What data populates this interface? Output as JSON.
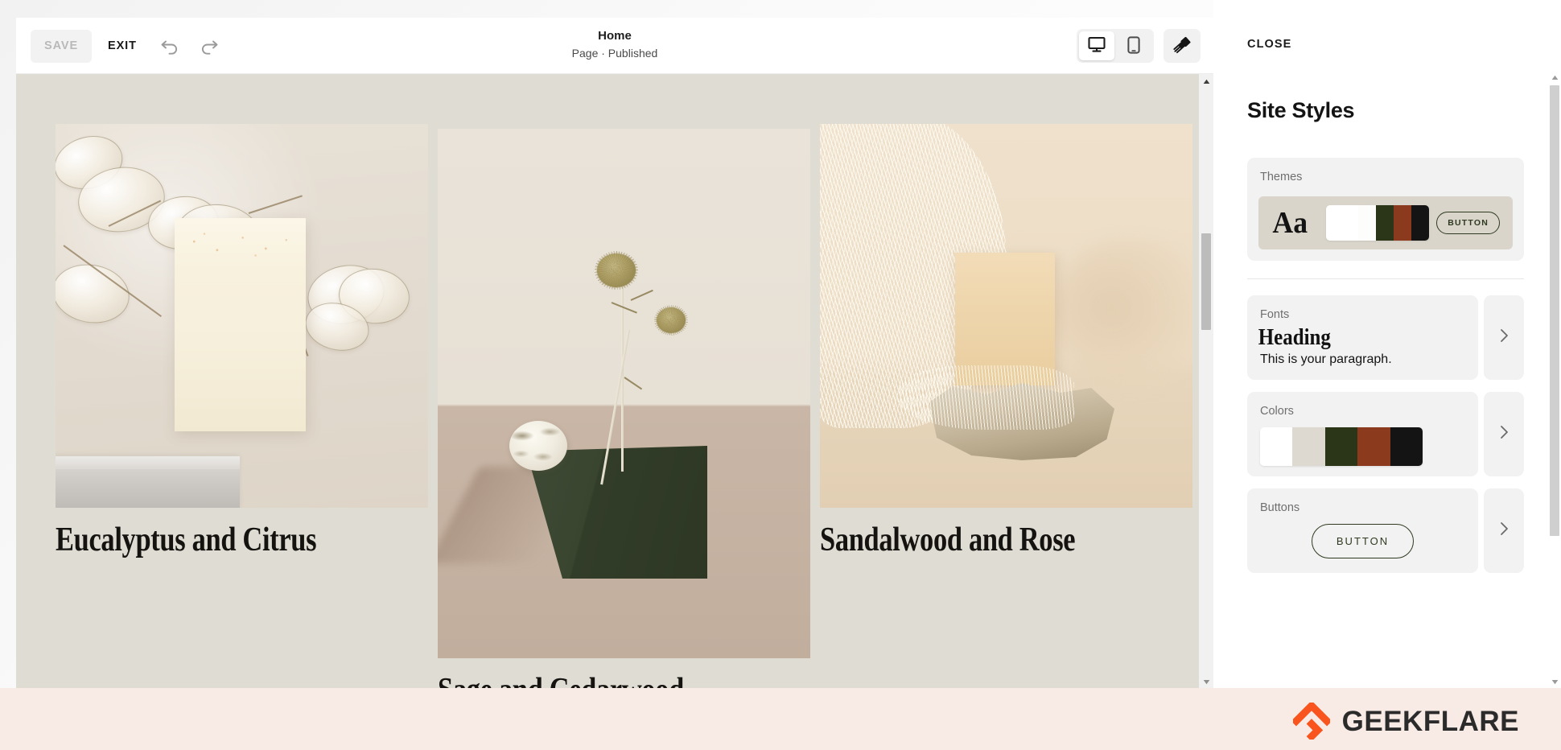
{
  "toolbar": {
    "save_label": "SAVE",
    "exit_label": "EXIT",
    "undo_icon": "undo-arrow-icon",
    "redo_icon": "redo-arrow-icon",
    "page_title": "Home",
    "page_status": "Page · Published",
    "desktop_icon": "desktop-monitor-icon",
    "mobile_icon": "mobile-phone-icon",
    "brush_icon": "paintbrush-icon",
    "active_device": "desktop"
  },
  "canvas": {
    "background_color": "#dfdcd4",
    "products": [
      {
        "title": "Eucalyptus and Citrus",
        "image_alt": "Cream soap bar on concrete block with dried lunaria pods"
      },
      {
        "title": "Sage and Cedarwood",
        "image_alt": "Dark green block with dried thistle stems and round soap"
      },
      {
        "title": "Sandalwood and Rose",
        "image_alt": "Tan soap bar on a rock with sisal fibers"
      }
    ]
  },
  "panel": {
    "close_label": "CLOSE",
    "title": "Site Styles",
    "themes": {
      "label": "Themes",
      "sample_text": "Aa",
      "button_label": "BUTTON",
      "swatches": [
        "#ffffff",
        "#ffffff",
        "#2b3618",
        "#8b3a1e",
        "#141414"
      ]
    },
    "fonts": {
      "label": "Fonts",
      "heading_sample": "Heading",
      "paragraph_sample": "This is your paragraph.",
      "chevron_icon": "chevron-right-icon"
    },
    "colors": {
      "label": "Colors",
      "swatches": [
        "#ffffff",
        "#ded9d0",
        "#2b3618",
        "#8b3a1e",
        "#141414"
      ],
      "chevron_icon": "chevron-right-icon"
    },
    "buttons": {
      "label": "Buttons",
      "preview_label": "BUTTON",
      "chevron_icon": "chevron-right-icon"
    }
  },
  "watermark": {
    "brand": "GEEKFLARE",
    "mark_icon": "geekflare-logo-icon",
    "accent_color": "#f9541e",
    "bar_color": "#f8ebe6"
  }
}
